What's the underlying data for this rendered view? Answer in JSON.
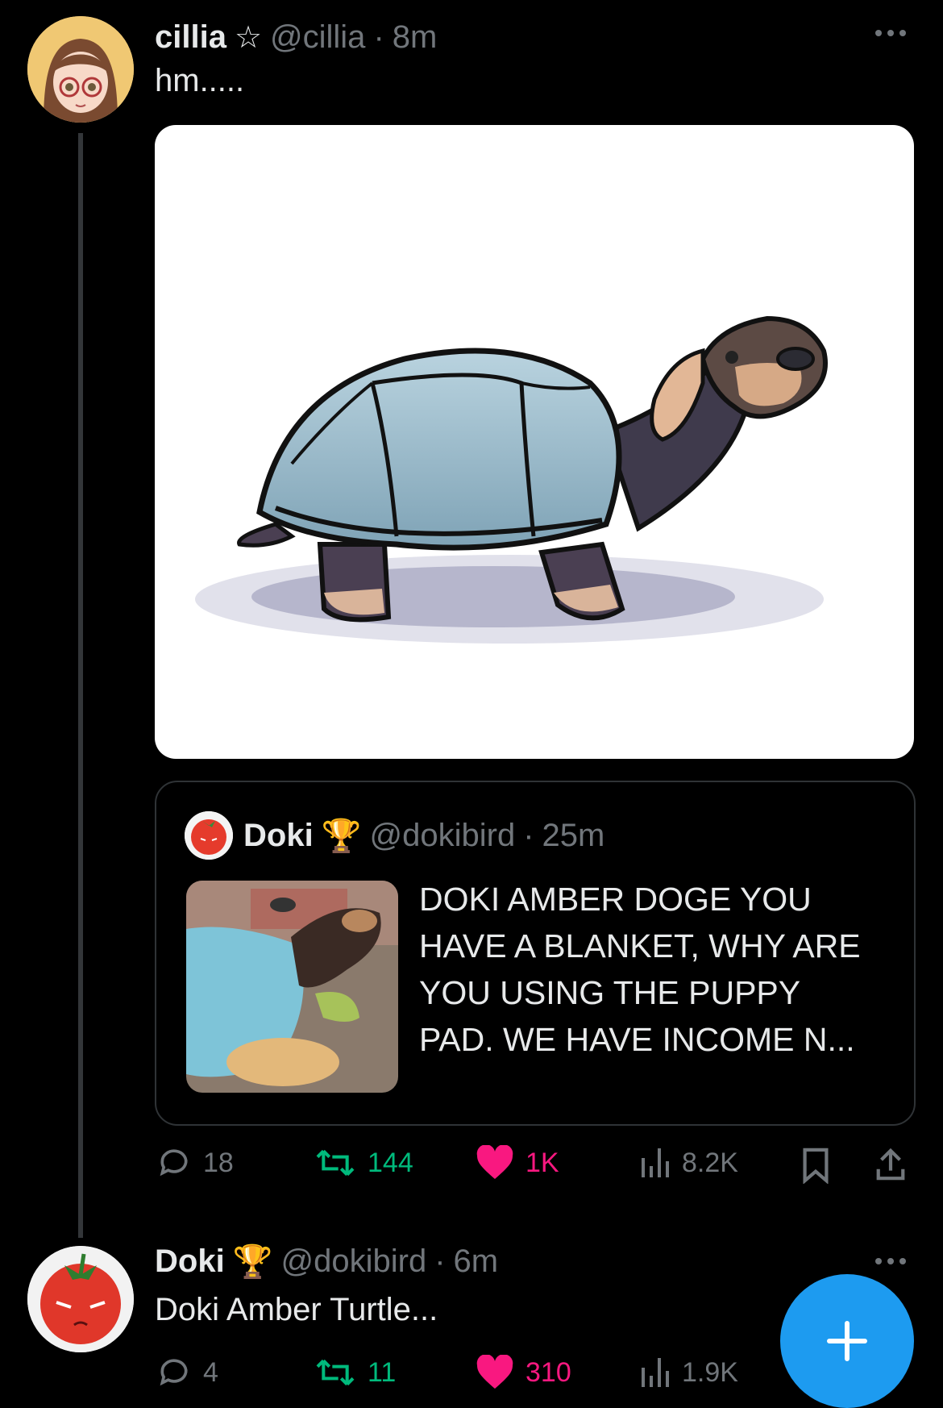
{
  "tweet1": {
    "name": "cillia",
    "badge": "☆",
    "handle": "@cillia",
    "sep": "·",
    "time": "8m",
    "text": "hm....."
  },
  "quote": {
    "name": "Doki",
    "badge": "🏆",
    "handle": "@dokibird",
    "sep": "·",
    "time": "25m",
    "text_lines": [
      "DOKI AMBER DOGE YOU",
      "HAVE A BLANKET, WHY ARE",
      "YOU USING THE PUPPY",
      "PAD. WE HAVE INCOME N..."
    ]
  },
  "tweet1_actions": {
    "replies": "18",
    "retweets": "144",
    "likes": "1K",
    "views": "8.2K"
  },
  "tweet2": {
    "name": "Doki",
    "badge": "🏆",
    "handle": "@dokibird",
    "sep": "·",
    "time": "6m",
    "text": "Doki Amber Turtle..."
  },
  "tweet2_actions": {
    "replies": "4",
    "retweets": "11",
    "likes": "310",
    "views": "1.9K"
  },
  "colors": {
    "retweet": "#00ba7c",
    "like": "#f91880",
    "fab": "#1d9bf0",
    "muted": "#71767b"
  },
  "icons": [
    "reply-icon",
    "retweet-icon",
    "heart-icon",
    "views-icon",
    "bookmark-icon",
    "share-icon",
    "plus-icon",
    "more-icon"
  ]
}
